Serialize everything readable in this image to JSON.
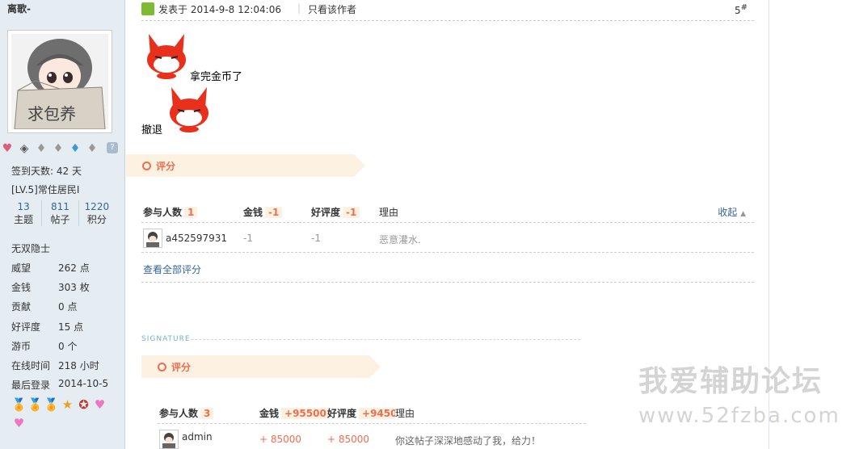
{
  "author": {
    "name": "离歌-",
    "medals_top": [
      "♥",
      "◈",
      "♦",
      "♦",
      "♦",
      "♦",
      "?"
    ],
    "checkin_days": "签到天数: 42 天",
    "level": "[LV.5]常住居民I",
    "counts": [
      {
        "num": "13",
        "label": "主题"
      },
      {
        "num": "811",
        "label": "帖子"
      },
      {
        "num": "1220",
        "label": "积分"
      }
    ],
    "title": "无双隐士",
    "info": [
      {
        "key": "威望",
        "value": "262 点"
      },
      {
        "key": "金钱",
        "value": "303 枚"
      },
      {
        "key": "贡献",
        "value": "0 点"
      },
      {
        "key": "好评度",
        "value": "15 点"
      },
      {
        "key": "游币",
        "value": "0 个"
      },
      {
        "key": "在线时间",
        "value": "218 小时"
      },
      {
        "key": "最后登录",
        "value": "2014-10-5"
      }
    ],
    "medals_bottom": [
      "🏅",
      "🏅",
      "🏅",
      "★",
      "✪",
      "♥",
      "♥"
    ],
    "avatar_text": "求包养"
  },
  "post": {
    "posted_at": "发表于 2014-9-8 12:04:06",
    "separator": "|",
    "author_only": "只看该作者",
    "floor_num": "5",
    "floor_mark": "#",
    "line1": "拿完金币了",
    "line2": "撤退"
  },
  "rating1": {
    "banner": "评分",
    "col_participants": "参与人数",
    "participants": "1",
    "col_money": "金钱",
    "money_total": "-1",
    "col_rep": "好评度",
    "rep_total": "-1",
    "col_reason": "理由",
    "collapse": "收起",
    "rows": [
      {
        "user": "a452597931",
        "money": "-1",
        "rep": "-1",
        "reason": "恶意灌水."
      }
    ],
    "view_all": "查看全部评分"
  },
  "signature_label": "SIGNATURE",
  "rating2": {
    "banner": "评分",
    "col_participants": "参与人数",
    "participants": "3",
    "col_money": "金钱",
    "money_total": "+95500",
    "col_rep": "好评度",
    "rep_total": "+9450",
    "col_reason": "理由",
    "rows": [
      {
        "user": "admin",
        "money": "+ 85000",
        "rep": "+ 85000",
        "reason": "你这帖子深深地感动了我，给力！"
      }
    ]
  },
  "watermark": {
    "line1": "我爱辅助论坛",
    "line2": "www.52fzba.com"
  },
  "colors": {
    "sidebar_bg": "#e5edf2",
    "accent": "#f26c4f",
    "link": "#336699",
    "banner_bg": "#fdf2e2"
  }
}
